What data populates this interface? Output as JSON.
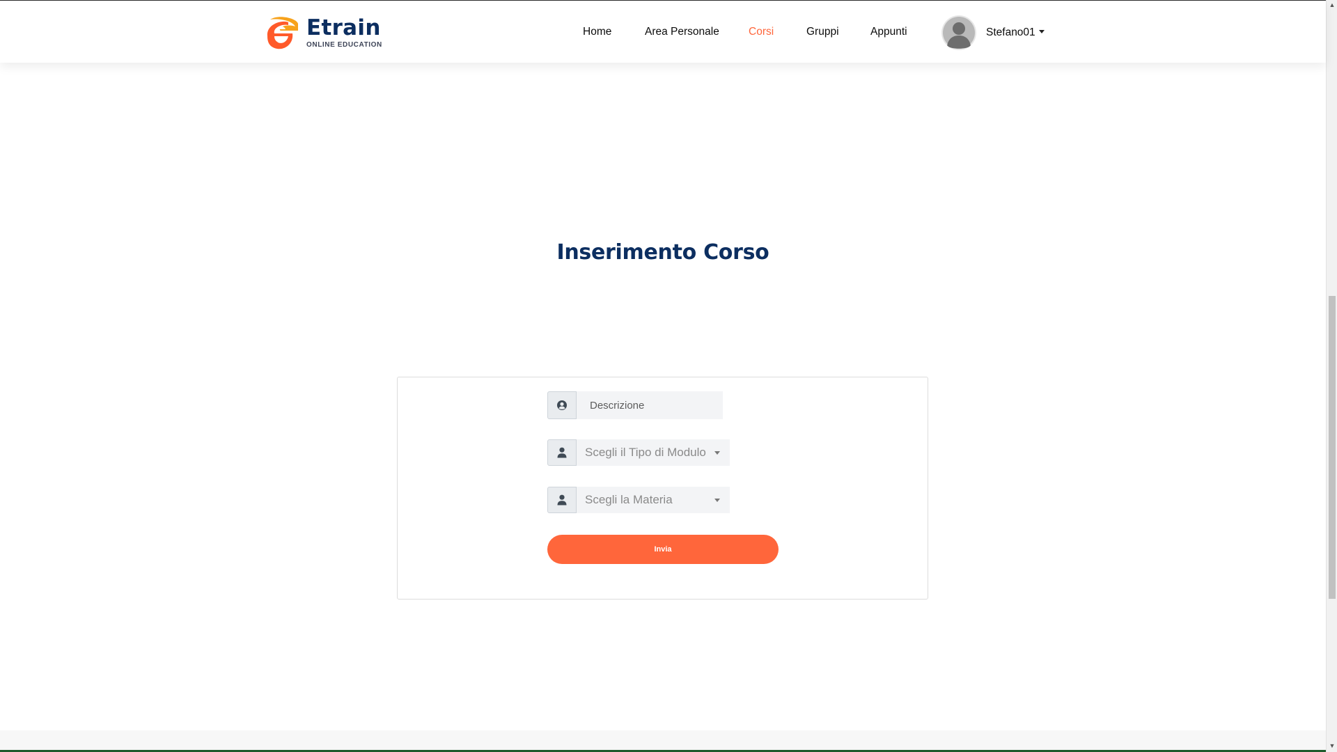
{
  "brand": {
    "name": "Etrain",
    "tagline": "ONLINE EDUCATION",
    "colors": {
      "primary": "#0c2e60",
      "accent": "#ff663b",
      "logo_orange": "#f7a21b"
    }
  },
  "nav": {
    "items": [
      {
        "label": "Home",
        "active": false
      },
      {
        "label": "Area Personale",
        "active": false
      },
      {
        "label": "Corsi",
        "active": true
      },
      {
        "label": "Gruppi",
        "active": false
      },
      {
        "label": "Appunti",
        "active": false
      }
    ],
    "user": {
      "name": "Stefano01",
      "avatar_icon": "user-silhouette-icon",
      "menu_icon": "caret-down-icon"
    }
  },
  "page": {
    "title": "Inserimento Corso"
  },
  "form": {
    "descrizione": {
      "placeholder": "Descrizione",
      "value": "",
      "icon": "user-circle-icon"
    },
    "tipo_modulo": {
      "selected": "Scegli il Tipo di Modulo",
      "icon": "user-icon"
    },
    "materia": {
      "selected": "Scegli la Materia",
      "icon": "user-icon"
    },
    "submit_label": "Invia"
  }
}
